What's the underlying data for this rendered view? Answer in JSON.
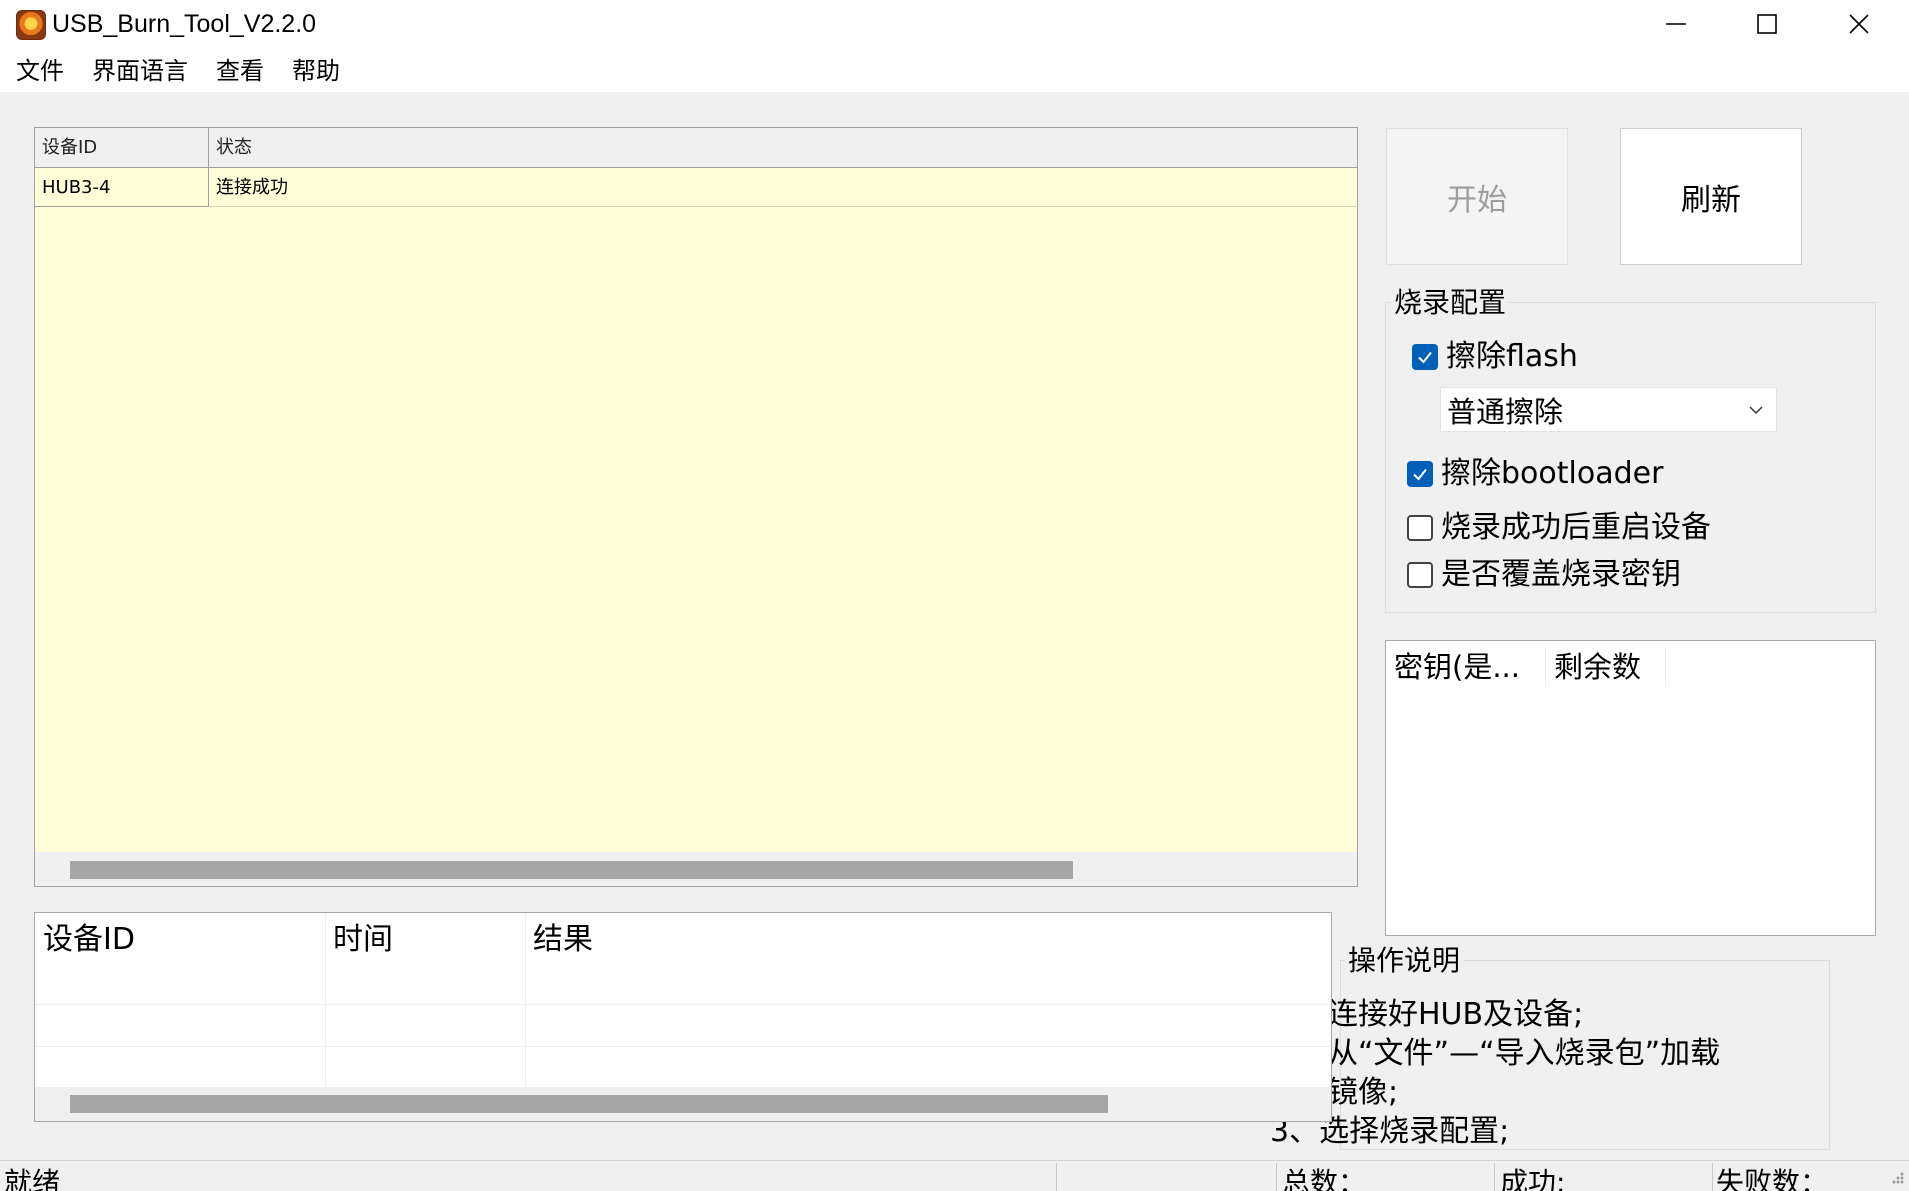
{
  "window": {
    "title": "USB_Burn_Tool_V2.2.0",
    "icon": "app-logo-icon"
  },
  "menu": [
    "文件",
    "界面语言",
    "查看",
    "帮助"
  ],
  "device_table": {
    "columns": [
      "设备ID",
      "状态"
    ],
    "rows": [
      {
        "device_id": "HUB3-4",
        "status": "连接成功"
      }
    ]
  },
  "buttons": {
    "start": "开始",
    "refresh": "刷新"
  },
  "burn_config": {
    "title": "烧录配置",
    "erase_flash": {
      "label": "擦除flash",
      "checked": true
    },
    "erase_mode": {
      "selected": "普通擦除"
    },
    "erase_bootloader": {
      "label": "擦除bootloader",
      "checked": true
    },
    "reboot_after": {
      "label": "烧录成功后重启设备",
      "checked": false
    },
    "overwrite_key": {
      "label": "是否覆盖烧录密钥",
      "checked": false
    }
  },
  "key_table": {
    "columns": [
      "密钥(是...",
      "剩余数"
    ]
  },
  "result_table": {
    "columns": [
      "设备ID",
      "时间",
      "结果"
    ]
  },
  "instructions": {
    "title": "操作说明",
    "lines": [
      "连接好HUB及设备;",
      "从“文件”—“导入烧录包”加载",
      "镜像;",
      "3、选择烧录配置;"
    ]
  },
  "status_bar": {
    "state": "就绪",
    "total": "总数：",
    "success": "成功:",
    "failed": "失败数："
  },
  "colors": {
    "accent": "#005fb8",
    "device_table_bg": "#fefed9",
    "scrollbar_thumb": "#a6a6a6"
  }
}
